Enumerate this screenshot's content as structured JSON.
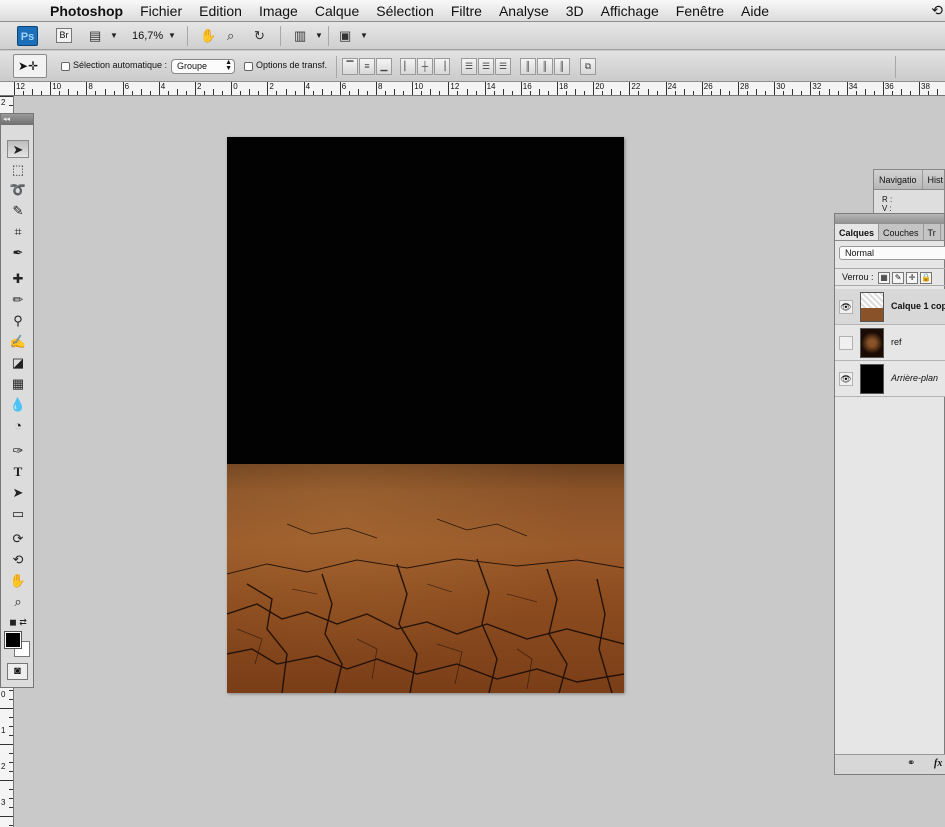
{
  "menubar": {
    "app_name": "Photoshop",
    "items": [
      "Fichier",
      "Edition",
      "Image",
      "Calque",
      "Sélection",
      "Filtre",
      "Analyse",
      "3D",
      "Affichage",
      "Fenêtre",
      "Aide"
    ]
  },
  "appbar": {
    "ps_logo": "Ps",
    "bridge_label": "Br",
    "zoom": "16,7%"
  },
  "options": {
    "auto_select_label": "Sélection automatique :",
    "auto_select_value": "Groupe",
    "transform_label": "Options de transf."
  },
  "ruler": {
    "h_labels": [
      "12",
      "10",
      "8",
      "6",
      "4",
      "2",
      "0",
      "2",
      "4",
      "6",
      "8",
      "10",
      "12",
      "14",
      "16",
      "18",
      "20",
      "22",
      "24",
      "26",
      "28",
      "30",
      "32",
      "34",
      "36",
      "38"
    ],
    "v_labels": [
      "2",
      "0",
      "1",
      "2",
      "3"
    ]
  },
  "navigator": {
    "tabs": [
      "Navigatio",
      "Hist"
    ],
    "readout": [
      "R :",
      "V :"
    ]
  },
  "layers": {
    "tabs": [
      "Calques",
      "Couches",
      "Tr"
    ],
    "blend_mode": "Normal",
    "lock_label": "Verrou :",
    "rows": [
      {
        "name": "Calque 1 cop",
        "visible": true,
        "selected": true
      },
      {
        "name": "ref",
        "visible": false,
        "selected": false
      },
      {
        "name": "Arrière-plan",
        "visible": true,
        "selected": false
      }
    ],
    "bottom_fx": "fx"
  },
  "colors": {
    "sky": "#020202",
    "ground": "#8a5228",
    "foreground_swatch": "#000000",
    "background_swatch": "#ffffff"
  }
}
